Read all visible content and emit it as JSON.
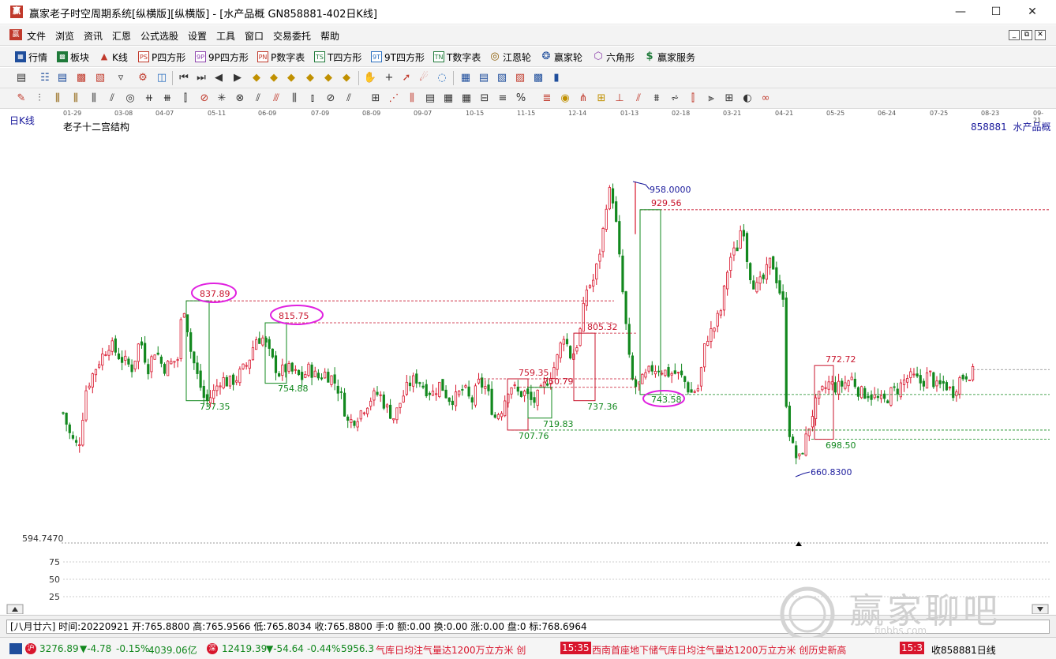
{
  "window": {
    "title": "赢家老子时空周期系统[纵横版][纵横版] - [水产品概  GN858881-402日K线]",
    "app_icon": "赢"
  },
  "menu": [
    "文件",
    "浏览",
    "资讯",
    "汇恩",
    "公式选股",
    "设置",
    "工具",
    "窗口",
    "交易委托",
    "帮助"
  ],
  "toolbar1": [
    {
      "label": "行情",
      "icon": "grid-icon",
      "color": "#1f4e9c"
    },
    {
      "label": "板块",
      "icon": "blocks-icon",
      "color": "#1f7a3a"
    },
    {
      "label": "K线",
      "icon": "kline-icon",
      "color": "#c0392b"
    },
    {
      "label": "P四方形",
      "icon": "ps-icon",
      "color": "#c0392b",
      "tag": "PS"
    },
    {
      "label": "9P四方形",
      "icon": "9p-icon",
      "color": "#8e44ad",
      "tag": "9P"
    },
    {
      "label": "P数字表",
      "icon": "pn-icon",
      "color": "#c0392b",
      "tag": "PN"
    },
    {
      "label": "T四方形",
      "icon": "ts-icon",
      "color": "#1f7a3a",
      "tag": "TS"
    },
    {
      "label": "9T四方形",
      "icon": "9t-icon",
      "color": "#2a6fbf",
      "tag": "9T"
    },
    {
      "label": "T数字表",
      "icon": "tn-icon",
      "color": "#1f7a3a",
      "tag": "TN"
    },
    {
      "label": "江恩轮",
      "icon": "wheel-icon",
      "color": "#8a5a00"
    },
    {
      "label": "赢家轮",
      "icon": "wheel2-icon",
      "color": "#1f4e9c"
    },
    {
      "label": "六角形",
      "icon": "hexagon-icon",
      "color": "#8e44ad"
    },
    {
      "label": "赢家服务",
      "icon": "dollar-icon",
      "color": "#1f7a3a"
    }
  ],
  "chart": {
    "period_label": "日K线",
    "structure_label": "老子十二宫结构",
    "code": "858881",
    "name": "水产品概",
    "scale_label": "594.7470",
    "dates": [
      "01-29",
      "03-08",
      "04-07",
      "05-11",
      "06-09",
      "07-09",
      "08-09",
      "09-07",
      "10-15",
      "11-15",
      "12-14",
      "01-13",
      "02-18",
      "03-21",
      "04-21",
      "05-25",
      "06-24",
      "07-25",
      "08-23",
      "09-21"
    ],
    "indicator_ticks": [
      "75",
      "50",
      "25"
    ],
    "annotations": {
      "high": "958.0000",
      "low": "660.8300",
      "a1": "929.56",
      "a2": "837.89",
      "a3": "815.75",
      "a4": "805.32",
      "a5": "772.72",
      "a6": "759.35",
      "a7": "754.88",
      "a8": "750.79",
      "a9": "743.58",
      "a10": "737.35",
      "a11": "737.36",
      "a12": "719.83",
      "a13": "707.76",
      "a14": "698.50"
    }
  },
  "infobar": "[八月廿六] 时间:20220921 开:765.8800 高:765.9566 低:765.8034 收:765.8800 手:0 额:0.00 换:0.00 涨:0.00 盘:0 标:768.6964",
  "ticker": {
    "index1": "3276.89",
    "index1_change": "▼-4.78",
    "index1_pct": "-0.15%",
    "index1_amount": "4039.06亿",
    "index2": "12419.39",
    "index2_change": "▼-54.64",
    "index2_pct": "-0.44%",
    "index2_amount": "5956.3",
    "news1": "气库日均注气量达1200万立方米 创",
    "time": "15:35",
    "news2": "西南首座地下储气库日均注气量达1200万立方米 创历史新高",
    "time2": "15:3",
    "right_label": "收858881日线"
  },
  "watermark": {
    "text": "赢家聊吧",
    "sub": "finbbs.com"
  },
  "colors": {
    "up": "#d8152c",
    "down": "#12881e",
    "annotation_high": "#1a1a9c",
    "highlight": "#e020e0"
  }
}
